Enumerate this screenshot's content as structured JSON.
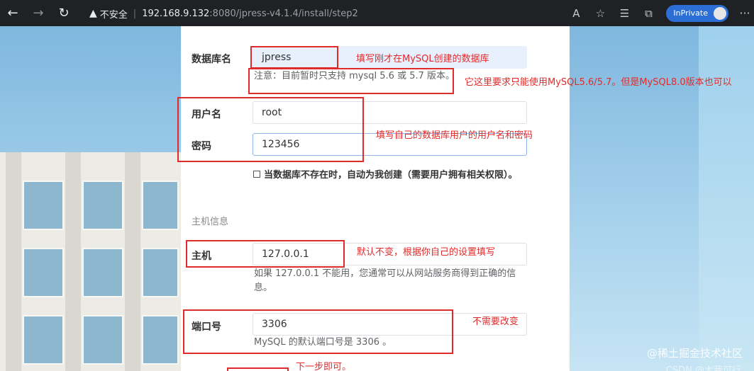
{
  "browser": {
    "back_icon": "←",
    "forward_icon": "→",
    "refresh_icon": "↻",
    "security_icon": "▲",
    "insecure_label": "不安全",
    "separator": "|",
    "url_host": "192.168.9.132",
    "url_path": ":8080/jpress-v4.1.4/install/step2",
    "read_aloud_icon": "A",
    "favorite_icon": "☆",
    "favorites_icon": "☰",
    "collections_icon": "⧉",
    "inprivate_label": "InPrivate",
    "more_icon": "···"
  },
  "form": {
    "db_name_label": "数据库名",
    "db_name_value": "jpress",
    "db_name_hint": "注意：目前暂时只支持 mysql 5.6 或 5.7 版本。",
    "username_label": "用户名",
    "username_value": "root",
    "password_label": "密码",
    "password_value": "123456",
    "create_db_label": "当数据库不存在时，自动为我创建（需要用户拥有相关权限）。",
    "host_section": "主机信息",
    "host_label": "主机",
    "host_value": "127.0.0.1",
    "host_hint": "如果 127.0.0.1 不能用，您通常可以从网站服务商得到正确的信息。",
    "port_label": "端口号",
    "port_value": "3306",
    "port_hint": "MySQL 的默认端口号是 3306 。"
  },
  "annotations": {
    "db_name_note": "填写刚才在MySQL创建的数据库",
    "version_note": "它这里要求只能使用MySQL5.6/5.7。但是MySQL8.0版本也可以",
    "credentials_note": "填写自己的数据库用户的用户名和密码",
    "host_note": "默认不变，根据你自己的设置填写",
    "port_note": "不需要改变",
    "next_note": "下一步即可。"
  },
  "watermark": "@稀土掘金技术社区",
  "watermark2": "CSDN @大我可行",
  "colors": {
    "annotation_red": "#e02b2b",
    "inprivate_blue": "#2b6fd6"
  }
}
